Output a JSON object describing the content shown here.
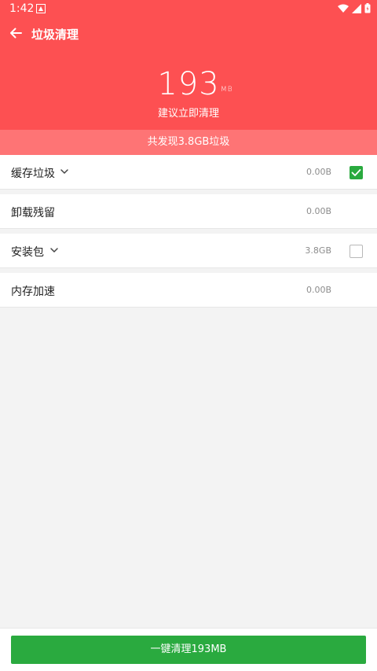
{
  "status_bar": {
    "time": "1:42"
  },
  "header": {
    "title": "垃圾清理",
    "size_value": "193",
    "size_unit": "MB",
    "suggestion": "建议立即清理",
    "found_text": "共发现3.8GB垃圾"
  },
  "rows": [
    {
      "label": "缓存垃圾",
      "size": "0.00B",
      "has_chevron": true,
      "checkbox": "checked"
    },
    {
      "label": "卸载残留",
      "size": "0.00B",
      "has_chevron": false,
      "checkbox": "none"
    },
    {
      "label": "安装包",
      "size": "3.8GB",
      "has_chevron": true,
      "checkbox": "unchecked"
    },
    {
      "label": "内存加速",
      "size": "0.00B",
      "has_chevron": false,
      "checkbox": "none"
    }
  ],
  "bottom": {
    "clean_button_label": "一键清理193MB"
  },
  "colors": {
    "header_red": "#fd5052",
    "found_bar": "#fe7475",
    "accent_green": "#2aaa3f",
    "background": "#f3f3f3"
  }
}
